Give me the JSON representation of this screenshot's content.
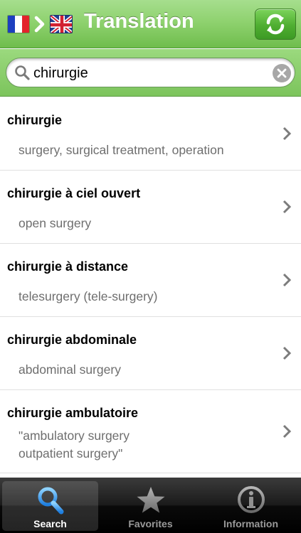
{
  "navbar": {
    "title": "Translation",
    "source_flag": "flag-france-icon",
    "target_flag": "flag-uk-icon",
    "direction_icon": "chevron-right-icon",
    "swap_icon": "swap-languages-icon",
    "bar_color": "#8fd26f",
    "button_color": "#4fae31"
  },
  "search": {
    "value": "chirurgie",
    "icon": "search-icon",
    "clear_icon": "clear-icon"
  },
  "results": [
    {
      "term": "chirurgie",
      "translation": "surgery, surgical treatment, operation"
    },
    {
      "term": "chirurgie à ciel ouvert",
      "translation": "open surgery"
    },
    {
      "term": "chirurgie à distance",
      "translation": "telesurgery (tele-surgery)"
    },
    {
      "term": "chirurgie abdominale",
      "translation": "abdominal surgery"
    },
    {
      "term": "chirurgie ambulatoire",
      "translation": "\"ambulatory surgery\noutpatient surgery\""
    }
  ],
  "tabbar": {
    "tabs": [
      {
        "label": "Search",
        "icon": "search-icon",
        "active": true
      },
      {
        "label": "Favorites",
        "icon": "star-icon",
        "active": false
      },
      {
        "label": "Information",
        "icon": "info-icon",
        "active": false
      }
    ],
    "active_color": "#4ea8ff"
  }
}
